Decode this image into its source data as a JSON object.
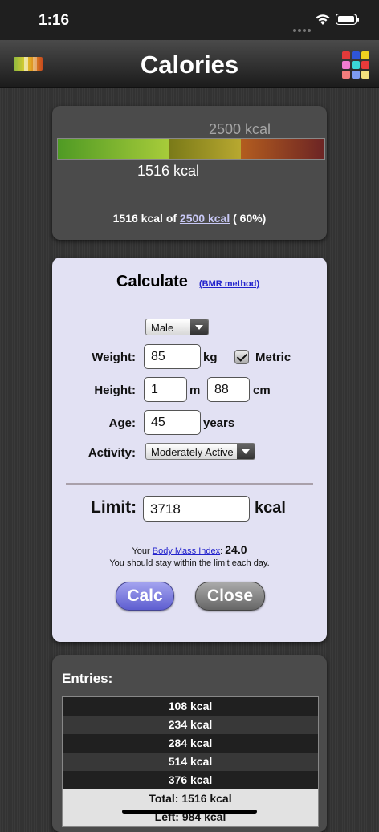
{
  "status": {
    "time": "1:16"
  },
  "header": {
    "title": "Calories"
  },
  "summary_panel": {
    "limit_label": "2500 kcal",
    "used_label": "1516 kcal",
    "summary_prefix": "1516 kcal of",
    "summary_link": "2500 kcal",
    "summary_suffix": "( 60%)",
    "percent_used": 60
  },
  "calculate": {
    "title": "Calculate",
    "bmr_link": "(BMR method)",
    "gender": "Male",
    "weight_label": "Weight:",
    "weight_value": "85",
    "weight_unit": "kg",
    "metric_label": "Metric",
    "height_label": "Height:",
    "height_m": "1",
    "height_m_unit": "m",
    "height_cm": "88",
    "height_cm_unit": "cm",
    "age_label": "Age:",
    "age_value": "45",
    "age_unit": "years",
    "activity_label": "Activity:",
    "activity_value": "Moderately Active",
    "limit_label": "Limit:",
    "limit_value": "3718",
    "limit_unit": "kcal",
    "bmi_prefix": "Your",
    "bmi_link": "Body Mass Index",
    "bmi_value": "24.0",
    "bmi_note": "You should stay within the limit each day.",
    "calc_button": "Calc",
    "close_button": "Close"
  },
  "entries": {
    "title": "Entries:",
    "rows": [
      "108 kcal",
      "234 kcal",
      "284 kcal",
      "514 kcal",
      "376 kcal"
    ],
    "total": "Total: 1516 kcal",
    "left": "Left: 984 kcal"
  },
  "colors": {
    "panel_dark": "#4b4b4b",
    "panel_light": "#e2e1f3",
    "calc_button": "#7b7be0",
    "close_button": "#888888"
  }
}
